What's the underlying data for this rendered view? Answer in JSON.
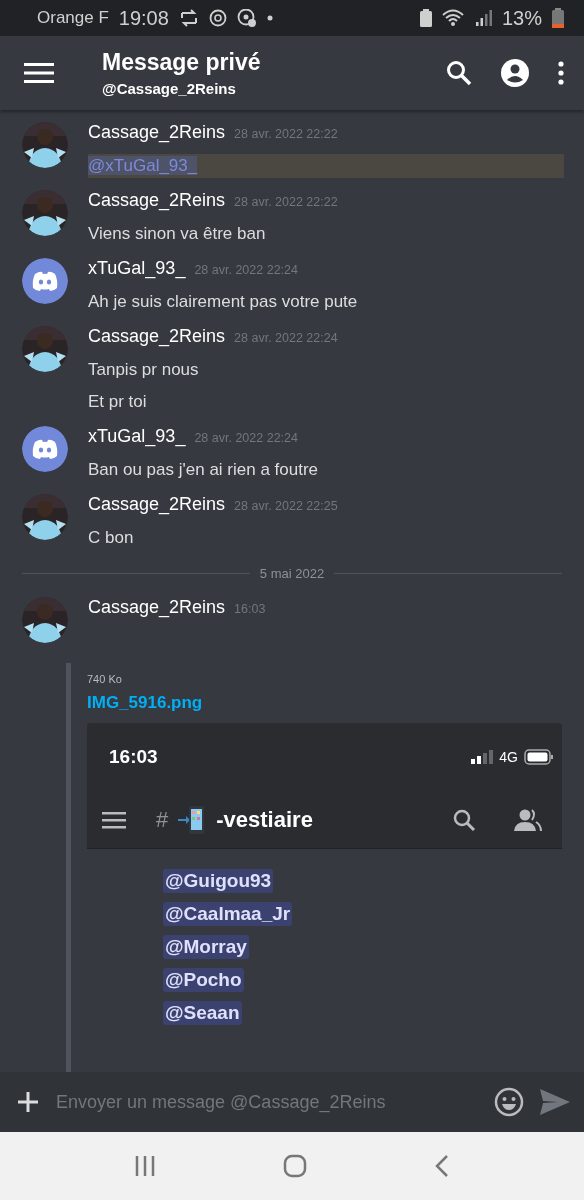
{
  "status_bar": {
    "carrier": "Orange F",
    "time": "19:08",
    "battery": "13%"
  },
  "header": {
    "title": "Message privé",
    "subtitle": "@Cassage_2Reins"
  },
  "messages": [
    {
      "kind": "message",
      "author": "Cassage_2Reins",
      "avatar": {
        "kind": "picture"
      },
      "timestamp": "28 avr. 2022 22:22",
      "lines": [
        {
          "kind": "mention",
          "text": "@xTuGal_93_"
        }
      ]
    },
    {
      "kind": "message",
      "author": "Cassage_2Reins",
      "avatar": {
        "kind": "picture"
      },
      "timestamp": "28 avr. 2022 22:22",
      "lines": [
        {
          "kind": "text",
          "text": "Viens sinon va être ban"
        }
      ]
    },
    {
      "kind": "message",
      "author": "xTuGal_93_",
      "avatar": {
        "kind": "logo"
      },
      "timestamp": "28 avr. 2022 22:24",
      "lines": [
        {
          "kind": "text",
          "text": "Ah je suis clairement pas votre pute"
        }
      ]
    },
    {
      "kind": "message",
      "author": "Cassage_2Reins",
      "avatar": {
        "kind": "picture"
      },
      "timestamp": "28 avr. 2022 22:24",
      "lines": [
        {
          "kind": "text",
          "text": "Tanpis pr nous"
        },
        {
          "kind": "text",
          "text": "Et pr toi"
        }
      ]
    },
    {
      "kind": "message",
      "author": "xTuGal_93_",
      "avatar": {
        "kind": "logo"
      },
      "timestamp": "28 avr. 2022 22:24",
      "lines": [
        {
          "kind": "text",
          "text": "Ban ou pas j'en ai rien a foutre"
        }
      ]
    },
    {
      "kind": "message",
      "author": "Cassage_2Reins",
      "avatar": {
        "kind": "picture"
      },
      "timestamp": "28 avr. 2022 22:25",
      "lines": [
        {
          "kind": "text",
          "text": "C bon"
        }
      ]
    },
    {
      "kind": "divider",
      "label": "5 mai 2022"
    },
    {
      "kind": "message",
      "author": "Cassage_2Reins",
      "avatar": {
        "kind": "picture"
      },
      "timestamp": "16:03",
      "attachment": {
        "size": "740 Ko",
        "filename": "IMG_5916.png",
        "screenshot": {
          "time": "16:03",
          "network": "4G",
          "channel_prefix": "#",
          "channel": "-vestiaire",
          "mentions": [
            "@Guigou93",
            "@Caalmaa_Jr",
            "@Morray",
            "@Pocho",
            "@Seaan"
          ]
        }
      }
    }
  ],
  "composer": {
    "placeholder": "Envoyer un message @Cassage_2Reins"
  }
}
